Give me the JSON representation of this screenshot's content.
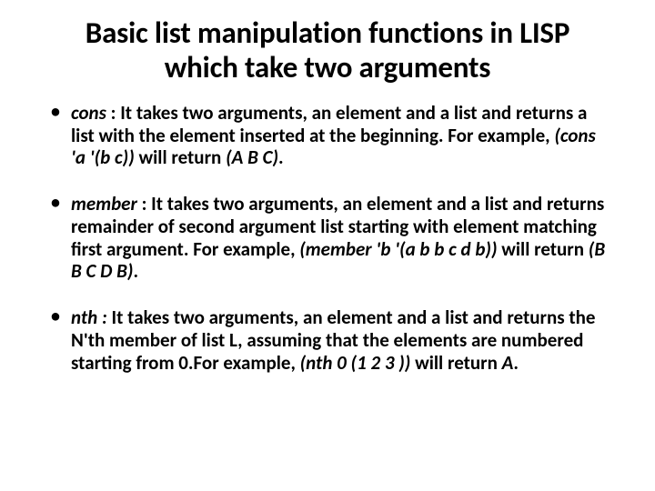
{
  "title": "Basic list manipulation functions in LISP which take two arguments",
  "items": [
    {
      "name": "cons",
      "sep": " : ",
      "desc": "It takes two arguments, an element and a list and returns a list with the element inserted at the beginning. For example, ",
      "example": "(cons 'a '(b c))",
      "mid": " will return ",
      "result": "(A B C)",
      "tail": "."
    },
    {
      "name": "member",
      "sep": " : ",
      "desc": "It takes two arguments, an element and a list and returns remainder of second argument list starting with element matching first argument. For example, ",
      "example": "(member 'b '(a b b c d b))",
      "mid": " will return ",
      "result": "(B B C D B)",
      "tail": "."
    },
    {
      "name": "nth :",
      "sep": " ",
      "desc": "It takes two arguments, an element and a list and returns the N'th member of list L, assuming that the elements are numbered starting from 0.For example, ",
      "example": "(nth 0 (1 2 3 ))",
      "mid": " will return ",
      "result": "A",
      "tail": "."
    }
  ]
}
